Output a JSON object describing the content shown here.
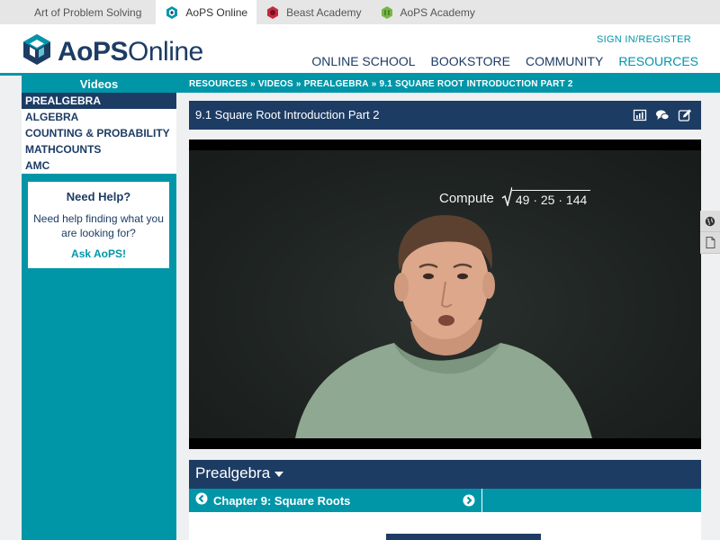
{
  "sitebar": {
    "sites": [
      {
        "label": "Art of Problem Solving",
        "icon": "none"
      },
      {
        "label": "AoPS Online",
        "icon": "aops-online-icon"
      },
      {
        "label": "Beast Academy",
        "icon": "beast-academy-icon"
      },
      {
        "label": "AoPS Academy",
        "icon": "aops-academy-icon"
      }
    ],
    "active_index": 1
  },
  "header": {
    "logo_bold": "AoPS",
    "logo_light": "Online",
    "signin": "SIGN IN/REGISTER",
    "nav": [
      "ONLINE SCHOOL",
      "BOOKSTORE",
      "COMMUNITY",
      "RESOURCES"
    ],
    "current_nav": "RESOURCES"
  },
  "sidebar": {
    "title": "Videos",
    "items": [
      "PREALGEBRA",
      "ALGEBRA",
      "COUNTING & PROBABILITY",
      "MATHCOUNTS",
      "AMC"
    ],
    "active_index": 0,
    "help": {
      "title": "Need Help?",
      "text": "Need help finding what you are looking for?",
      "link": "Ask AoPS!"
    }
  },
  "breadcrumb": {
    "items": [
      "RESOURCES",
      "VIDEOS",
      "PREALGEBRA",
      "9.1 SQUARE ROOT INTRODUCTION PART 2"
    ],
    "separator": "»"
  },
  "video": {
    "title": "9.1 Square Root Introduction Part 2",
    "tools": [
      "stats-icon",
      "comments-icon",
      "edit-icon"
    ],
    "overlay_word": "Compute",
    "overlay_radicand": "49 · 25 · 144"
  },
  "side_tools": [
    "globe-icon",
    "document-icon"
  ],
  "course": {
    "title": "Prealgebra",
    "chapter": "Chapter 9: Square Roots"
  },
  "colors": {
    "navy": "#1d3c64",
    "teal": "#0096a8",
    "beast_red": "#c8283c",
    "academy_green": "#7ab648"
  }
}
